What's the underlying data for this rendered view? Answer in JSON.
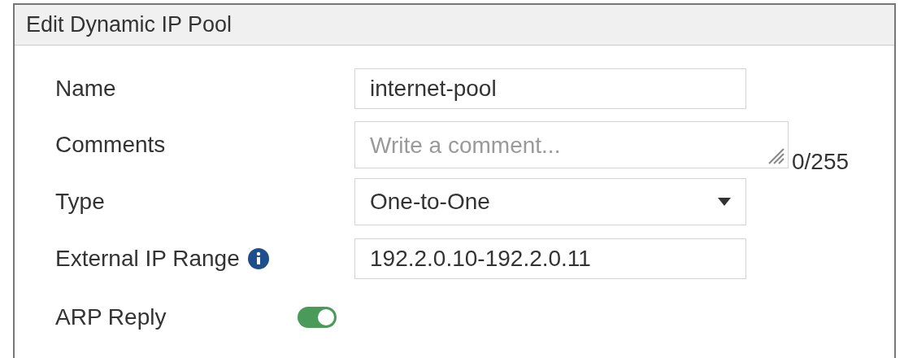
{
  "window": {
    "title": "Edit Dynamic IP Pool"
  },
  "fields": [
    {
      "kind": "text",
      "label": "Name",
      "value": "internet-pool"
    },
    {
      "kind": "textarea",
      "label": "Comments",
      "placeholder": "Write a comment...",
      "counter": "0/255"
    },
    {
      "kind": "select",
      "label": "Type",
      "value": "One-to-One"
    },
    {
      "kind": "text",
      "label": "External IP Range",
      "value": "192.2.0.10-192.2.0.11",
      "info": true
    },
    {
      "kind": "toggle",
      "label": "ARP Reply",
      "on": true
    }
  ]
}
